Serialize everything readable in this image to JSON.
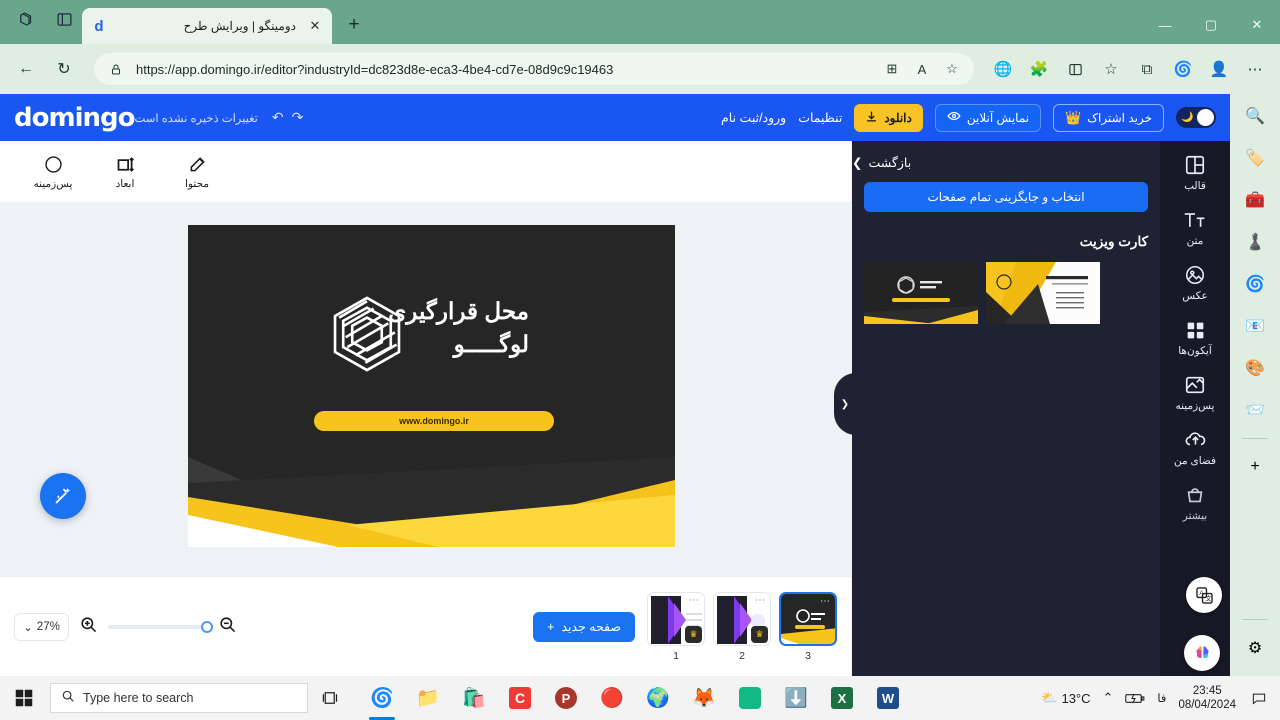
{
  "browser": {
    "tab_search_icon": "tab-search-icon",
    "tab_list_icon": "tab-list-icon",
    "tab_title": "دومینگو | ویرایش طرح",
    "tab_favicon": "d",
    "tab_close": "✕",
    "new_tab": "+",
    "minimize": "—",
    "maximize": "▢",
    "close": "✕",
    "back": "←",
    "reload": "↻",
    "url": "https://app.domingo.ir/editor?industryId=dc823d8e-eca3-4be4-cd7e-08d9c9c19463",
    "lock_icon": "🔒",
    "split_icon": "⊞",
    "read_aloud_icon": "A",
    "favorite_icon": "☆",
    "settings_icon": "⋯"
  },
  "edge_rail": {
    "icons": [
      "search-icon",
      "shopping-tag-icon",
      "tools-icon",
      "games-icon",
      "copilot-icon",
      "outlook-icon",
      "image-creator-icon",
      "telegram-icon"
    ],
    "add_label": "+",
    "settings_label": "⚙"
  },
  "header": {
    "logo": "domingo",
    "unsaved_text": "تغییرات ذخیره نشده است",
    "undo_icon": "↶",
    "redo_icon": "↷",
    "dark_toggle": "moon-icon",
    "subscribe_label": "خرید اشتراک",
    "subscribe_icon": "crown-icon",
    "preview_label": "نمایش آنلاین",
    "preview_icon": "eye-icon",
    "download_label": "دانلود",
    "download_icon": "download-icon",
    "settings_label": "تنظیمات",
    "login_label": "ورود/ثبت نام",
    "accent_blue": "#1a56f0",
    "accent_yellow": "#f7c325"
  },
  "toolbar": {
    "items": [
      {
        "label": "محتوا",
        "icon": "pencil-edit-icon"
      },
      {
        "label": "ابعاد",
        "icon": "resize-icon"
      },
      {
        "label": "پس‌زمینه",
        "icon": "circle-icon"
      }
    ]
  },
  "canvas": {
    "card_title_line1": "محل قرارگیری",
    "card_title_line2": "لوگـــــو",
    "card_url": "www.domingo.ir",
    "card_bg": "#262626",
    "card_yellow": "#f7c41d",
    "logo_icon": "hexagon-logo-icon",
    "collapse_icon": "▼",
    "ai_icon": "magic-wand-icon"
  },
  "bottombar": {
    "zoom_value": "27%",
    "zoom_chevron": "⌄",
    "zoom_in_icon": "zoom-in-icon",
    "zoom_out_icon": "zoom-out-icon",
    "new_page_label": "صفحه جدید",
    "new_page_icon": "+",
    "pages": [
      {
        "number": "1",
        "selected": false,
        "premium": true
      },
      {
        "number": "2",
        "selected": false,
        "premium": true
      },
      {
        "number": "3",
        "selected": true,
        "premium": false
      }
    ],
    "dots_icon": "⋯",
    "crown_icon": "♛"
  },
  "panel": {
    "back_label": "بازگشت",
    "back_icon": "❯",
    "cta_label": "انتخاب و جایگزینی تمام صفحات",
    "section_title": "کارت ویزیت",
    "handle_icon": "❯"
  },
  "sidebar": {
    "items": [
      {
        "label": "قالب",
        "icon": "template-icon"
      },
      {
        "label": "متن",
        "icon": "text-icon"
      },
      {
        "label": "عکس",
        "icon": "image-icon"
      },
      {
        "label": "آیکون‌ها",
        "icon": "grid-icons-icon"
      },
      {
        "label": "پس‌زمینه",
        "icon": "background-icon"
      },
      {
        "label": "فضای من",
        "icon": "cloud-upload-icon"
      },
      {
        "label": "بیشتر",
        "icon": "more-icon"
      }
    ],
    "translate_bubble": "translate-icon",
    "ai-bubble": "brain-ai-icon"
  },
  "taskbar": {
    "start_icon": "windows-start-icon",
    "search_placeholder": "Type here to search",
    "search_icon": "search-icon",
    "taskview_icon": "task-view-icon",
    "apps": [
      "edge-icon",
      "file-explorer-icon",
      "microsoft-store-icon",
      "camtasia-icon",
      "photoshop-icon",
      "chrome-icon",
      "firefox-browser-icon",
      "firefox-icon",
      "app-green-icon",
      "idm-icon",
      "excel-icon",
      "word-icon"
    ],
    "weather_temp": "13°C",
    "weather_icon": "weather-sun-cloud-icon",
    "chevron_icon": "⌃",
    "battery_icon": "battery-charging-icon",
    "language": "فا",
    "time": "23:45",
    "date": "08/04/2024",
    "notification_icon": "notification-icon"
  }
}
